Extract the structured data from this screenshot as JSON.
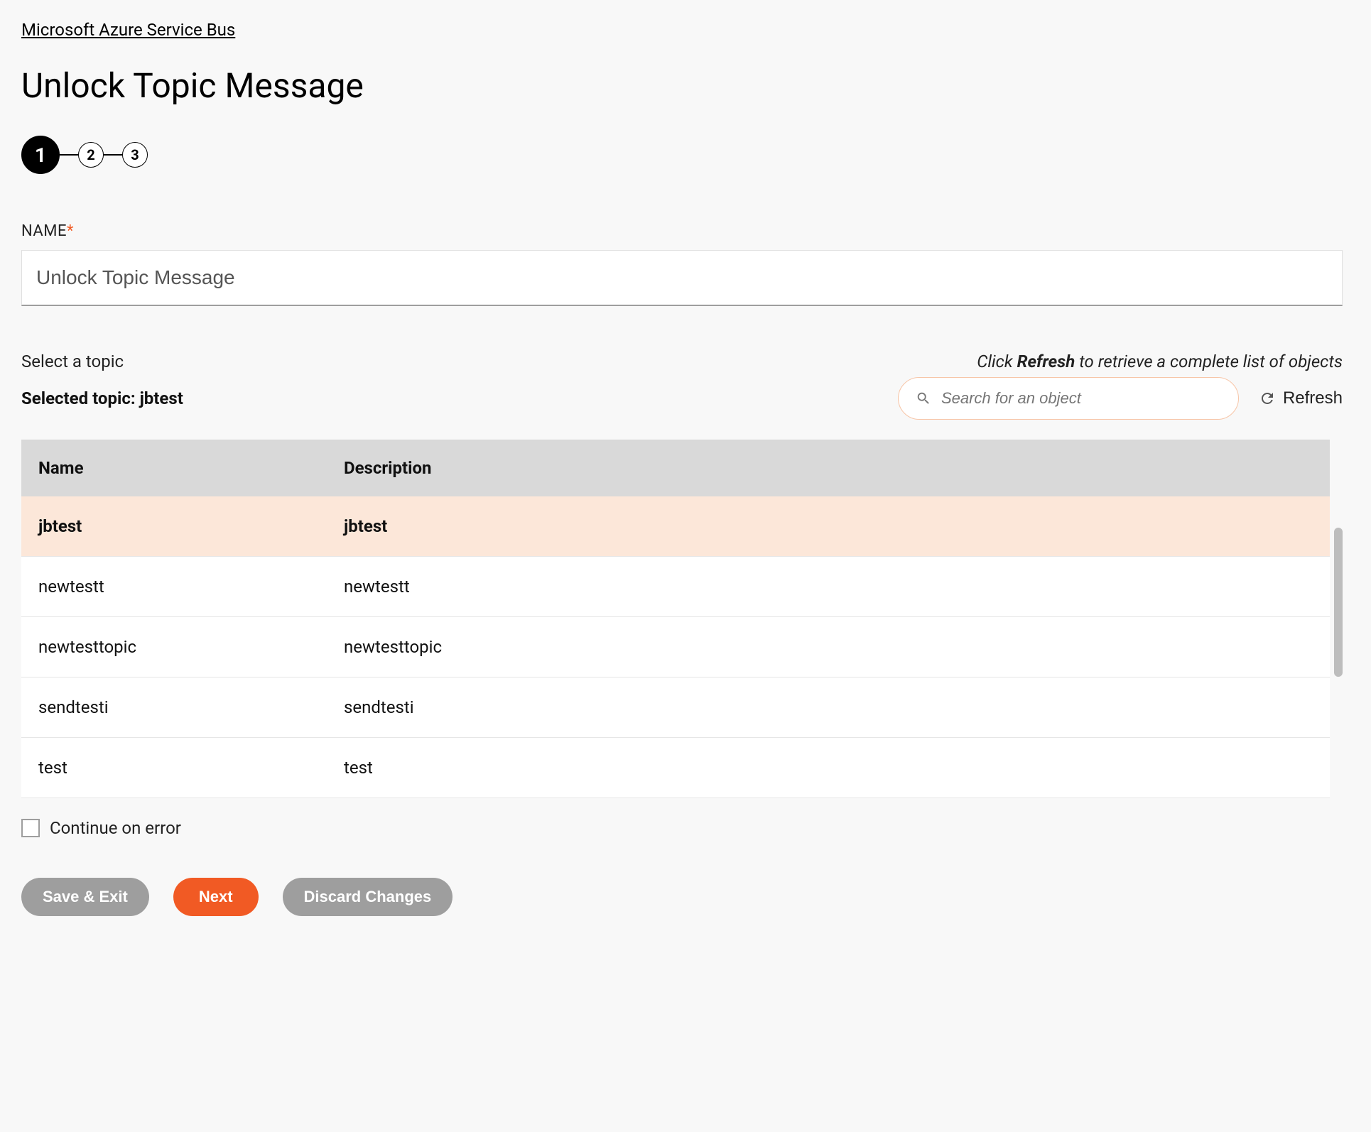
{
  "breadcrumb": "Microsoft Azure Service Bus",
  "page_title": "Unlock Topic Message",
  "stepper": {
    "steps": [
      "1",
      "2",
      "3"
    ],
    "active_index": 0
  },
  "name_field": {
    "label": "NAME",
    "required_mark": "*",
    "value": "Unlock Topic Message"
  },
  "topic": {
    "select_label": "Select a topic",
    "hint_prefix": "Click ",
    "hint_bold": "Refresh",
    "hint_suffix": " to retrieve a complete list of objects",
    "selected_prefix": "Selected topic: ",
    "selected_value": "jbtest"
  },
  "search": {
    "placeholder": "Search for an object"
  },
  "refresh_label": "Refresh",
  "table": {
    "columns": [
      "Name",
      "Description"
    ],
    "rows": [
      {
        "name": "jbtest",
        "description": "jbtest",
        "selected": true
      },
      {
        "name": "newtestt",
        "description": "newtestt",
        "selected": false
      },
      {
        "name": "newtesttopic",
        "description": "newtesttopic",
        "selected": false
      },
      {
        "name": "sendtesti",
        "description": "sendtesti",
        "selected": false
      },
      {
        "name": "test",
        "description": "test",
        "selected": false
      }
    ]
  },
  "continue_on_error_label": "Continue on error",
  "buttons": {
    "save_exit": "Save & Exit",
    "next": "Next",
    "discard": "Discard Changes"
  }
}
